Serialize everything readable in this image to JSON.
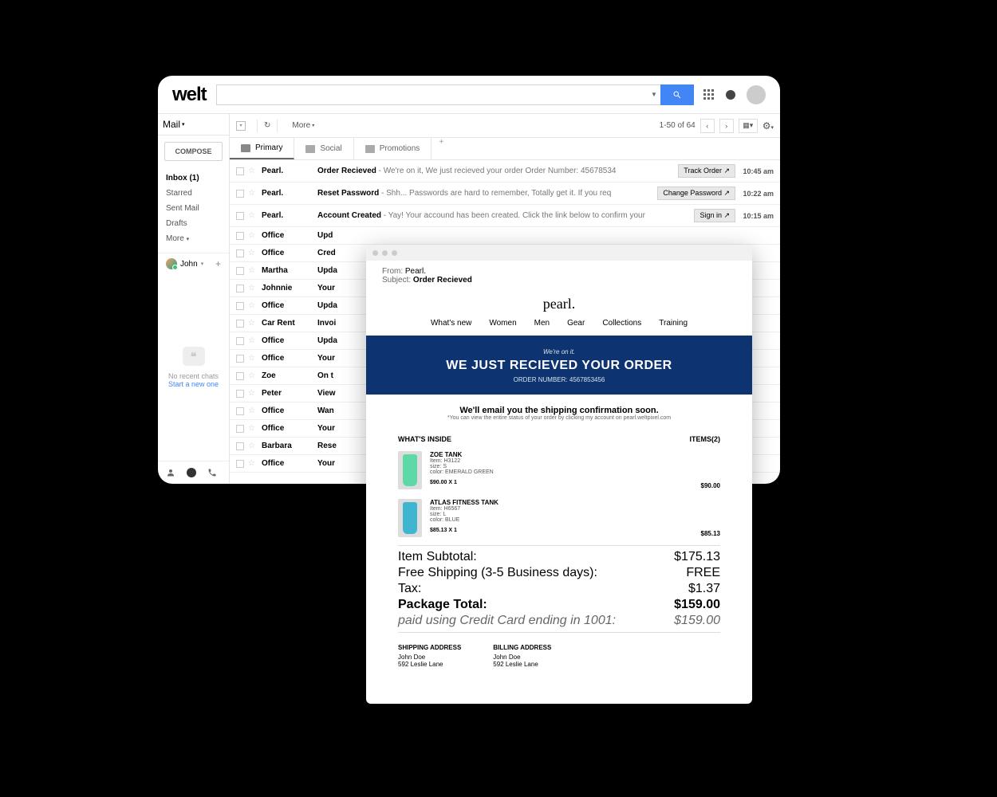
{
  "header": {
    "logo": "welt",
    "search_placeholder": ""
  },
  "sidebar": {
    "mail_label": "Mail",
    "compose": "COMPOSE",
    "folders": {
      "inbox": "Inbox (1)",
      "starred": "Starred",
      "sent": "Sent Mail",
      "drafts": "Drafts",
      "more": "More"
    },
    "user": "John",
    "no_chats": "No recent chats",
    "start_chat": "Start a new one"
  },
  "toolbar": {
    "more": "More",
    "count": "1-50 of 64"
  },
  "tabs": {
    "primary": "Primary",
    "social": "Social",
    "promotions": "Promotions"
  },
  "messages": [
    {
      "sender": "Pearl.",
      "subject": "Order Recieved",
      "preview": " - We're on it, We just recieved your order Order Number: 45678534",
      "button": "Track Order ↗",
      "time": "10:45 am"
    },
    {
      "sender": "Pearl.",
      "subject": "Reset Password",
      "preview": " - Shh... Passwords are hard to remember, Totally get it. If you req",
      "button": "Change Password ↗",
      "time": "10:22 am"
    },
    {
      "sender": "Pearl.",
      "subject": "Account Created",
      "preview": " - Yay! Your accound has been created. Click the link below to confirm your",
      "button": "Sign in ↗",
      "time": "10:15 am"
    },
    {
      "sender": "Office",
      "subject": "Upd",
      "preview": "",
      "button": "",
      "time": ""
    },
    {
      "sender": "Office",
      "subject": "Cred",
      "preview": "",
      "button": "",
      "time": ""
    },
    {
      "sender": "Martha",
      "subject": "Upda",
      "preview": "",
      "button": "",
      "time": ""
    },
    {
      "sender": "Johnnie",
      "subject": "Your",
      "preview": "",
      "button": "",
      "time": ""
    },
    {
      "sender": "Office",
      "subject": "Upda",
      "preview": "",
      "button": "",
      "time": ""
    },
    {
      "sender": "Car Rent",
      "subject": "Invoi",
      "preview": "",
      "button": "",
      "time": ""
    },
    {
      "sender": "Office",
      "subject": "Upda",
      "preview": "",
      "button": "",
      "time": ""
    },
    {
      "sender": "Office",
      "subject": "Your",
      "preview": "",
      "button": "",
      "time": ""
    },
    {
      "sender": "Zoe",
      "subject": "On t",
      "preview": "",
      "button": "",
      "time": ""
    },
    {
      "sender": "Peter",
      "subject": "View",
      "preview": "",
      "button": "",
      "time": ""
    },
    {
      "sender": "Office",
      "subject": "Wan",
      "preview": "",
      "button": "",
      "time": ""
    },
    {
      "sender": "Office",
      "subject": "Your",
      "preview": "",
      "button": "",
      "time": ""
    },
    {
      "sender": "Barbara",
      "subject": "Rese",
      "preview": "",
      "button": "",
      "time": ""
    },
    {
      "sender": "Office",
      "subject": "Your",
      "preview": "",
      "button": "",
      "time": ""
    }
  ],
  "email": {
    "from_label": "From:",
    "from": "Pearl.",
    "subject_label": "Subject:",
    "subject": "Order Recieved",
    "brand": "pearl.",
    "nav": [
      "What's new",
      "Women",
      "Men",
      "Gear",
      "Collections",
      "Training"
    ],
    "hero_small": "We're on it.",
    "hero_title": "WE JUST RECIEVED YOUR ORDER",
    "hero_order": "ORDER NUMBER: 4567853456",
    "confirm_main": "We'll email you the shipping confirmation soon.",
    "confirm_sub": "*You can view the entire status of your order by clicking my account on pearl.weltpixel.com",
    "whats_inside": "WHAT'S INSIDE",
    "items_count": "ITEMS(2)",
    "items": [
      {
        "name": "ZOE TANK",
        "item": "Item: H3122",
        "size": "size: S",
        "color": "color: EMERALD GREEN",
        "qty": "$90.00 X 1",
        "price": "$90.00",
        "swatch": "#5dd9a8"
      },
      {
        "name": "ATLAS FITNESS TANK",
        "item": "Item: H6567",
        "size": "size: L",
        "color": "color: BLUE",
        "qty": "$85.13 X 1",
        "price": "$85.13",
        "swatch": "#3fb5d0"
      }
    ],
    "totals": [
      {
        "label": "Item Subtotal:",
        "value": "$175.13",
        "bold": false
      },
      {
        "label": "Free Shipping (3-5 Business days):",
        "value": "FREE",
        "bold": false
      },
      {
        "label": "Tax:",
        "value": "$1.37",
        "bold": false
      },
      {
        "label": "Package Total:",
        "value": "$159.00",
        "bold": true
      },
      {
        "label": "paid using Credit Card ending in 1001:",
        "value": "$159.00",
        "bold": false,
        "italic": true
      }
    ],
    "shipping": {
      "title": "SHIPPING ADDRESS",
      "name": "John Doe",
      "addr": "592 Leslie Lane"
    },
    "billing": {
      "title": "BILLING ADDRESS",
      "name": "John Doe",
      "addr": "592 Leslie Lane"
    }
  }
}
